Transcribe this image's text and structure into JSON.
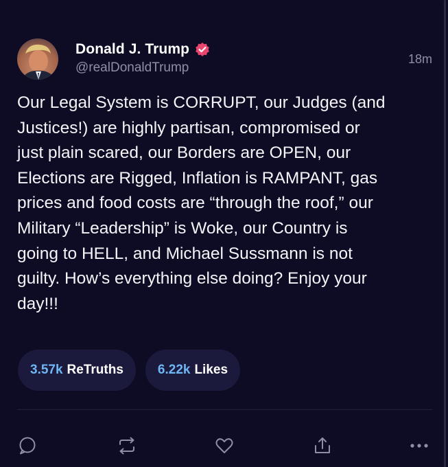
{
  "post": {
    "author": {
      "display_name": "Donald J. Trump",
      "handle": "@realDonaldTrump",
      "avatar_icon": "avatar",
      "verified_icon": "verified-badge-icon"
    },
    "timestamp": "18m",
    "text": "Our Legal System is CORRUPT, our Judges (and\nJustices!) are highly partisan, compromised or\njust plain scared, our Borders are OPEN, our\nElections are Rigged, Inflation is RAMPANT, gas\nprices and food costs are “through the roof,” our\nMilitary “Leadership” is Woke, our Country is\ngoing to HELL, and Michael Sussmann is not\nguilty. How’s everything else doing? Enjoy your\nday!!!",
    "stats": {
      "retruths_count": "3.57k",
      "retruths_label": "ReTruths",
      "likes_count": "6.22k",
      "likes_label": "Likes"
    },
    "actions": [
      "reply-icon",
      "retruth-icon",
      "like-icon",
      "share-icon",
      "more-icon"
    ]
  },
  "colors": {
    "background": "#0e0c24",
    "pill_background": "#1c1a3c",
    "count_accent": "#6fb6f5",
    "verified": "#e9466f",
    "muted_text": "#8f8ea6"
  }
}
